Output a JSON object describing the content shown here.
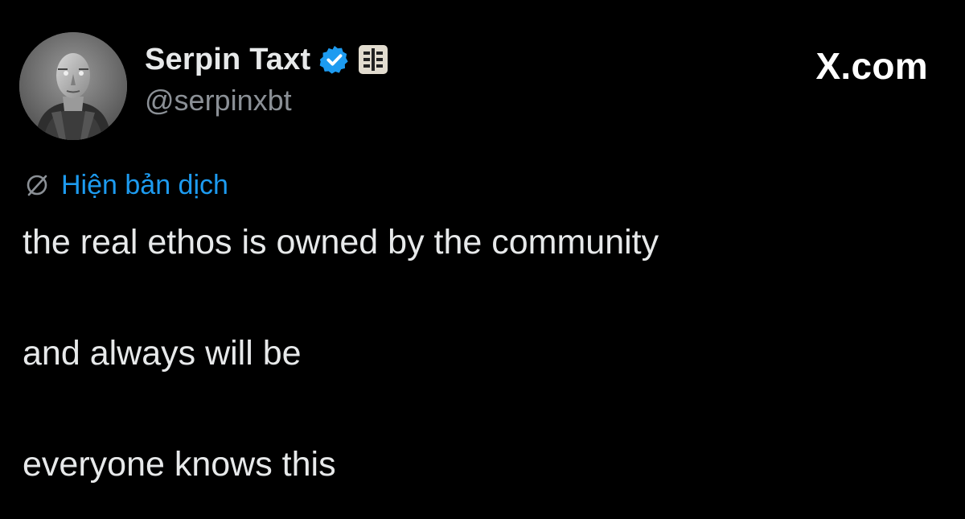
{
  "author": {
    "display_name": "Serpin Taxt",
    "handle": "@serpinxbt",
    "avatar_icon": "person-portrait-icon",
    "verified_icon": "verified-badge-icon",
    "affiliate_icon": "affiliate-badge-icon"
  },
  "brand": {
    "label": "X.com"
  },
  "translate": {
    "icon": "translate-icon",
    "label": "Hiện bản dịch"
  },
  "tweet": {
    "lines": [
      "the real ethos is owned by the community",
      "and always will be",
      "everyone knows this"
    ]
  },
  "colors": {
    "background": "#000000",
    "text": "#e7e9ea",
    "muted": "#8b9096",
    "link": "#1d9bf0",
    "verified": "#1d9bf0"
  }
}
